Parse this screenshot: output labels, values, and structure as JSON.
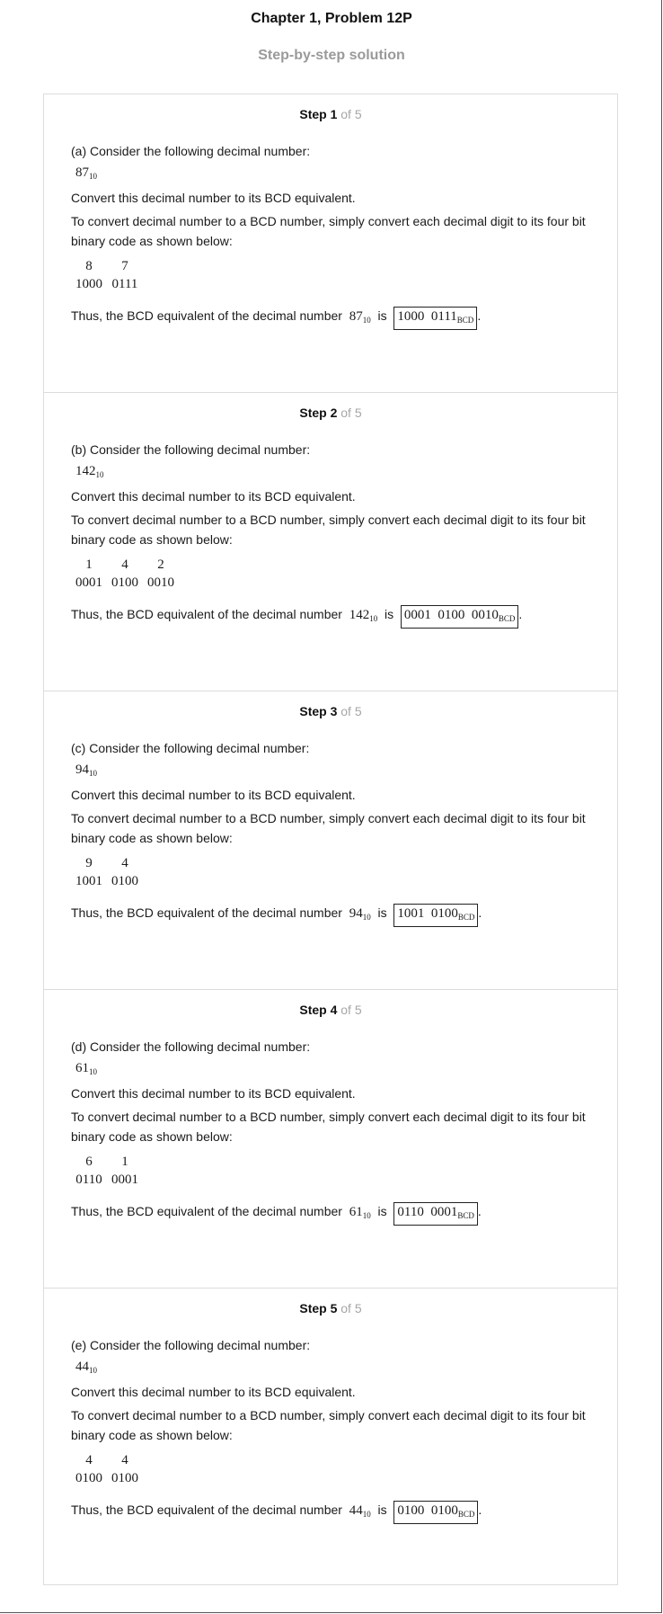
{
  "header": {
    "title": "Chapter 1, Problem 12P",
    "subtitle": "Step-by-step solution"
  },
  "steps": [
    {
      "label": "Step 1",
      "of": "of 5",
      "consider": "(a) Consider the following decimal number:",
      "number": "87",
      "base": "10",
      "convert": "Convert this decimal number to its BCD equivalent.",
      "explain": "To convert decimal number to a BCD number, simply convert each decimal digit to its four bit binary code as shown below:",
      "digits": [
        "8",
        "7"
      ],
      "codes": [
        "1000",
        "0111"
      ],
      "thus": "Thus, the BCD equivalent of the decimal number",
      "is": "is",
      "answer": "1000  0111",
      "answer_sub": "BCD",
      "period": "."
    },
    {
      "label": "Step 2",
      "of": "of 5",
      "consider": "(b) Consider the following decimal number:",
      "number": "142",
      "base": "10",
      "convert": "Convert this decimal number to its BCD equivalent.",
      "explain": "To convert decimal number to a BCD number, simply convert each decimal digit to its four bit binary code as shown below:",
      "digits": [
        "1",
        "4",
        "2"
      ],
      "codes": [
        "0001",
        "0100",
        "0010"
      ],
      "thus": "Thus, the BCD equivalent of the decimal number",
      "is": "is",
      "answer": "0001  0100  0010",
      "answer_sub": "BCD",
      "period": "."
    },
    {
      "label": "Step 3",
      "of": "of 5",
      "consider": "(c) Consider the following decimal number:",
      "number": "94",
      "base": "10",
      "convert": "Convert this decimal number to its BCD equivalent.",
      "explain": "To convert decimal number to a BCD number, simply convert each decimal digit to its four bit binary code as shown below:",
      "digits": [
        "9",
        "4"
      ],
      "codes": [
        "1001",
        "0100"
      ],
      "thus": "Thus, the BCD equivalent of the decimal number",
      "is": "is",
      "answer": "1001  0100",
      "answer_sub": "BCD",
      "period": "."
    },
    {
      "label": "Step 4",
      "of": "of 5",
      "consider": "(d) Consider the following decimal number:",
      "number": "61",
      "base": "10",
      "convert": "Convert this decimal number to its BCD equivalent.",
      "explain": "To convert decimal number to a BCD number, simply convert each decimal digit to its four bit binary code as shown below:",
      "digits": [
        "6",
        "1"
      ],
      "codes": [
        "0110",
        "0001"
      ],
      "thus": "Thus, the BCD equivalent of the decimal number",
      "is": "is",
      "answer": "0110  0001",
      "answer_sub": "BCD",
      "period": "."
    },
    {
      "label": "Step 5",
      "of": "of 5",
      "consider": "(e) Consider the following decimal number:",
      "number": "44",
      "base": "10",
      "convert": "Convert this decimal number to its BCD equivalent.",
      "explain": "To convert decimal number to a BCD number, simply convert each decimal digit to its four bit binary code as shown below:",
      "digits": [
        "4",
        "4"
      ],
      "codes": [
        "0100",
        "0100"
      ],
      "thus": "Thus, the BCD equivalent of the decimal number",
      "is": "is",
      "answer": "0100  0100",
      "answer_sub": "BCD",
      "period": "."
    }
  ]
}
